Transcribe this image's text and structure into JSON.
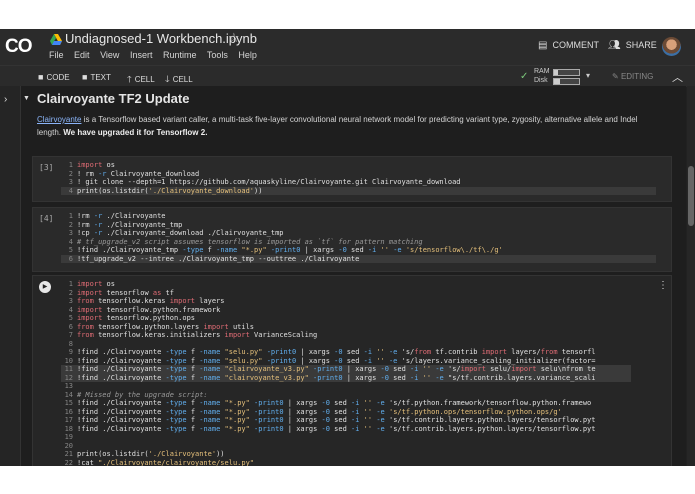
{
  "header": {
    "logo": "CO",
    "title": "Undiagnosed-1 Workbench.ipynb",
    "menu": [
      "File",
      "Edit",
      "View",
      "Insert",
      "Runtime",
      "Tools",
      "Help"
    ],
    "comment_label": "COMMENT",
    "share_label": "SHARE"
  },
  "toolbar": {
    "code_label": "CODE",
    "text_label": "TEXT",
    "cell_up_label": "CELL",
    "cell_down_label": "CELL",
    "ram_label": "RAM",
    "disk_label": "Disk",
    "ram_fraction": 0.15,
    "disk_fraction": 0.25,
    "editing_label": "EDITING"
  },
  "section": {
    "title": "Clairvoyante TF2 Update",
    "intro_link": "Clairvoyante",
    "intro_text": " is a Tensorflow based variant caller, a multi-task five-layer convolutional neural network model for predicting variant type, zygosity, alternative allele and Indel length. ",
    "intro_bold": "We have upgraded it for Tensorflow 2."
  },
  "cells": [
    {
      "label": "[3]",
      "lines": [
        "import os",
        "! rm -r Clairvoyante_download",
        "! git clone --depth=1 https://github.com/aquaskyline/Clairvoyante.git Clairvoyante_download",
        "print(os.listdir('./Clairvoyante_download'))"
      ]
    },
    {
      "label": "[4]",
      "lines": [
        "!rm -r ./Clairvoyante",
        "!rm -r ./Clairvoyante_tmp",
        "!cp -r ./Clairvoyante_download ./Clairvoyante_tmp",
        "# tf_upgrade_v2 script assumes tensorflow is imported as `tf` for pattern matching",
        "!find ./Clairvoyante_tmp -type f -name \"*.py\" -print0 | xargs -0 sed -i '' -e 's/tensorflow\\./tf\\./g'",
        "!tf_upgrade_v2 --intree ./Clairvoyante_tmp --outtree ./Clairvoyante"
      ]
    },
    {
      "label": "",
      "lines": [
        "import os",
        "import tensorflow as tf",
        "from tensorflow.keras import layers",
        "import tensorflow.python.framework",
        "import tensorflow.python.ops",
        "from tensorflow.python.layers import utils",
        "from tensorflow.keras.initializers import VarianceScaling",
        "",
        "!find ./Clairvoyante -type f -name \"selu.py\" -print0 | xargs -0 sed -i '' -e 's/from tf.contrib import layers/from tensorfl",
        "!find ./Clairvoyante -type f -name \"selu.py\" -print0 | xargs -0 sed -i '' -e 's/layers.variance_scaling_initializer(factor=",
        "!find ./Clairvoyante -type f -name \"clairvoyante_v3.py\" -print0 | xargs -0 sed -i '' -e 's/import selu/import selu\\nfrom te",
        "!find ./Clairvoyante -type f -name \"clairvoyante_v3.py\" -print0 | xargs -0 sed -i '' -e \"s/tf.contrib.layers.variance_scali",
        "",
        "# Missed by the upgrade script:",
        "!find ./Clairvoyante -type f -name \"*.py\" -print0 | xargs -0 sed -i '' -e 's/tf.python.framework/tensorflow.python.framewo",
        "!find ./Clairvoyante -type f -name \"*.py\" -print0 | xargs -0 sed -i '' -e 's/tf.python.ops/tensorflow.python.ops/g'",
        "!find ./Clairvoyante -type f -name \"*.py\" -print0 | xargs -0 sed -i '' -e 's/tf.contrib.layers.python.layers/tensorflow.pyt",
        "!find ./Clairvoyante -type f -name \"*.py\" -print0 | xargs -0 sed -i '' -e 's/tf.contrib.layers.python.layers/tensorflow.pyt",
        "",
        "",
        "print(os.listdir('./Clairvoyante'))",
        "!cat \"./Clairvoyante/clairvoyante/selu.py\""
      ]
    }
  ]
}
